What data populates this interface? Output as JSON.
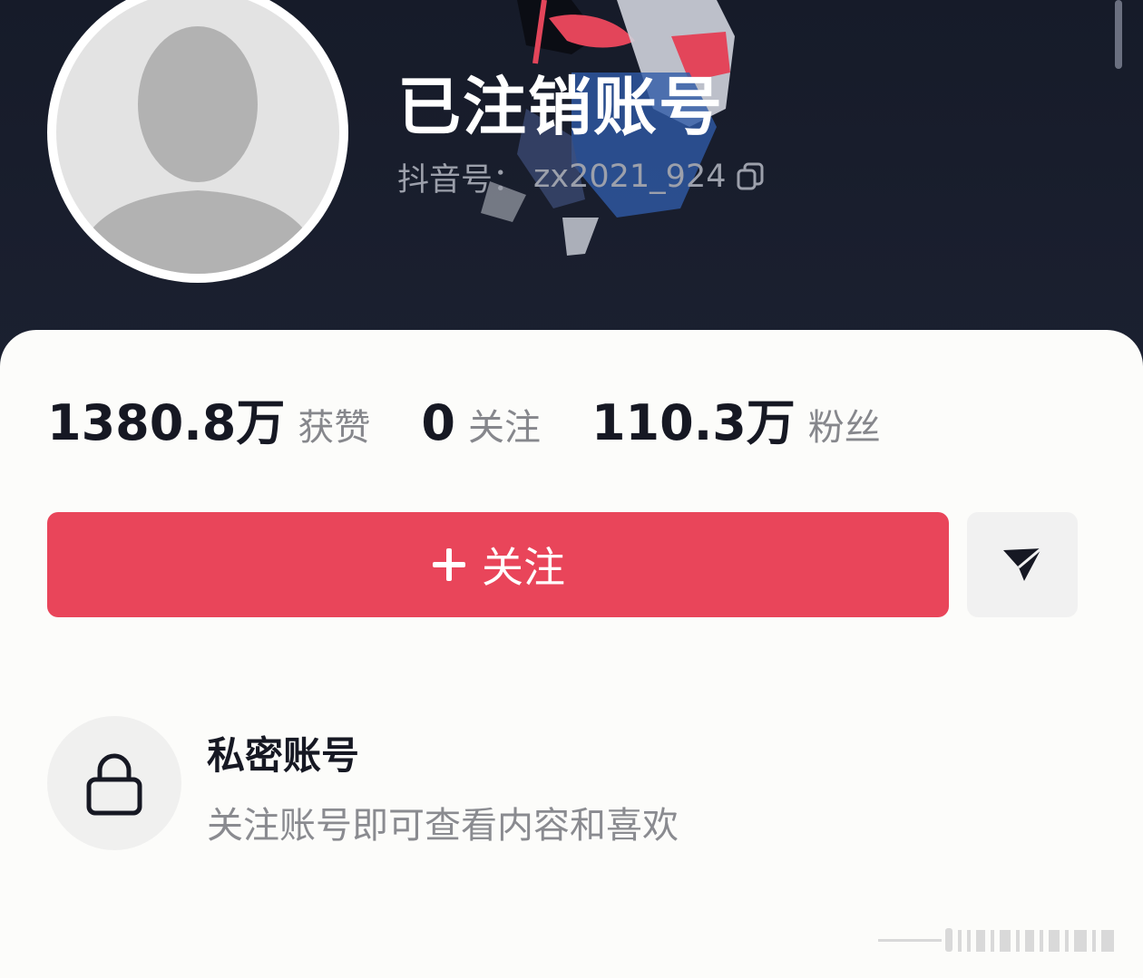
{
  "profile": {
    "nickname": "已注销账号",
    "id_label": "抖音号：",
    "id_value": "zx2021_924"
  },
  "stats": [
    {
      "value": "1380.8万",
      "label": "获赞"
    },
    {
      "value": "0",
      "label": "关注"
    },
    {
      "value": "110.3万",
      "label": "粉丝"
    }
  ],
  "actions": {
    "follow_label": "关注"
  },
  "private_notice": {
    "title": "私密账号",
    "description": "关注账号即可查看内容和喜欢"
  },
  "colors": {
    "accent": "#e9455a",
    "header_bg": "#161b29",
    "card_bg": "#fcfcfa"
  },
  "icons": {
    "copy": "copy-icon",
    "plus": "plus-icon",
    "share": "paper-plane-icon",
    "lock": "lock-icon",
    "avatar": "default-avatar-icon"
  }
}
